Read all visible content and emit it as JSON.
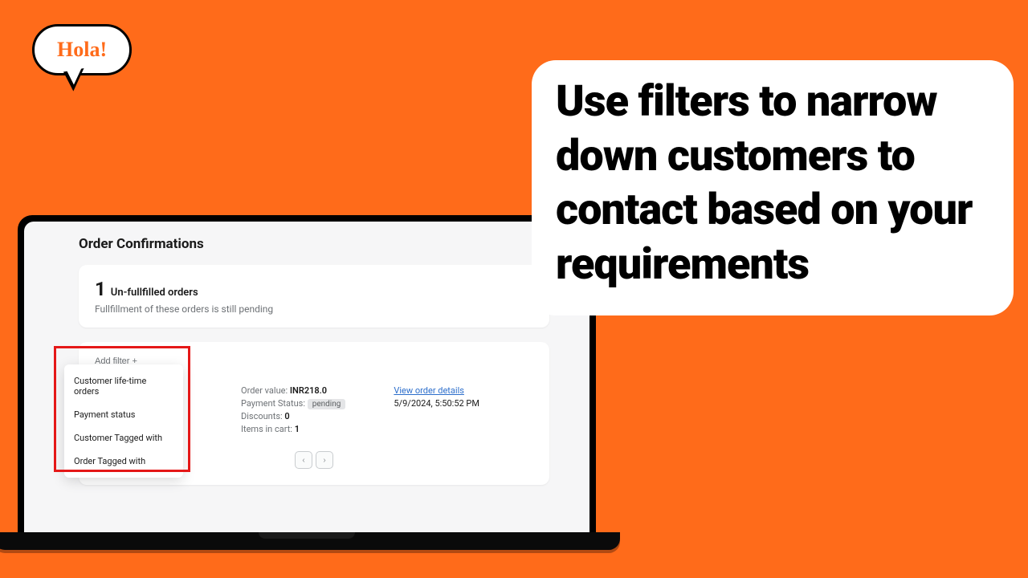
{
  "speech_bubble": {
    "text": "Hola!"
  },
  "callout": {
    "text": "Use filters to narrow down customers to contact based on your requirements"
  },
  "app": {
    "title": "Order Confirmations",
    "stats": {
      "count": "1",
      "label": "Un-fullfilled orders",
      "description": "Fullfillment of these orders is still pending"
    },
    "filter": {
      "add_label": "Add filter +",
      "options": [
        "Customer life-time orders",
        "Payment status",
        "Customer Tagged with",
        "Order Tagged with"
      ]
    },
    "order": {
      "value_label": "Order value: ",
      "value": "INR218.0",
      "payment_label": "Payment Status: ",
      "payment_value": "pending",
      "discounts_label": "Discounts: ",
      "discounts_value": "0",
      "items_label": "Items in cart: ",
      "items_value": "1",
      "view_link": "View order details",
      "timestamp": "5/9/2024, 5:50:52 PM"
    },
    "pagination": {
      "prev": "‹",
      "next": "›"
    }
  }
}
